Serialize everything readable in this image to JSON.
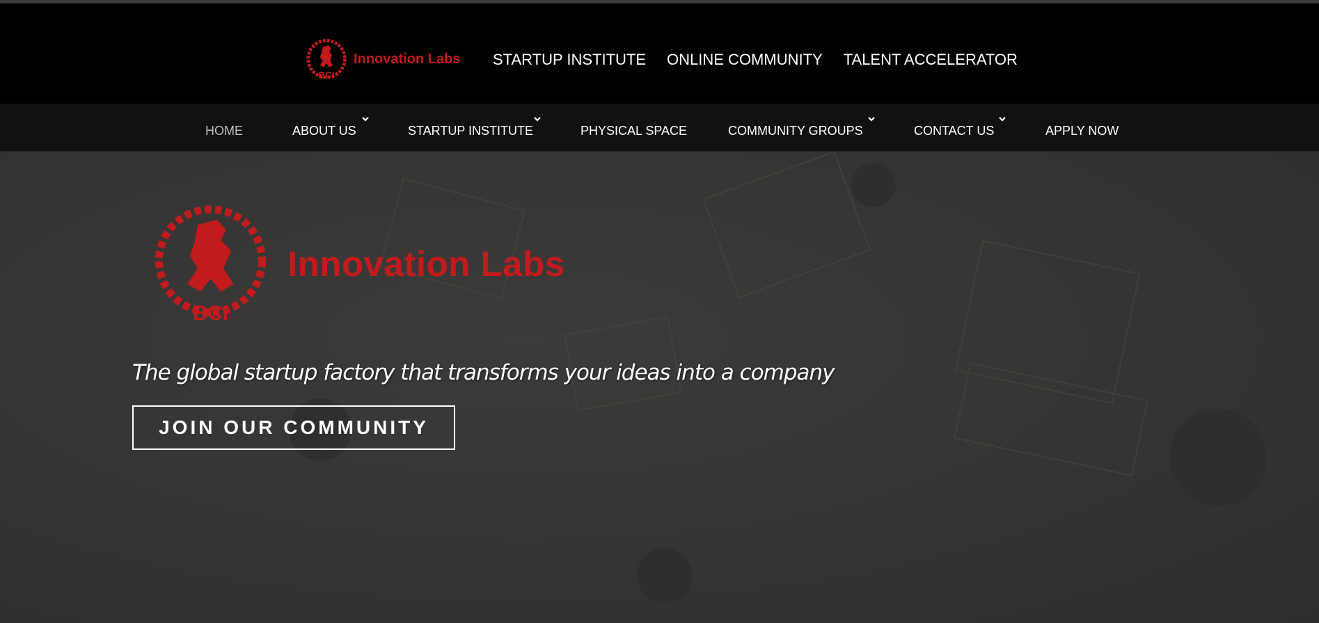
{
  "header": {
    "logo_alt": "BCI",
    "logo_text": "Innovation Labs",
    "top_links": [
      "STARTUP INSTITUTE",
      "ONLINE COMMUNITY",
      "TALENT ACCELERATOR"
    ]
  },
  "nav": {
    "items": [
      {
        "label": "HOME",
        "active": true,
        "has_dropdown": false
      },
      {
        "label": "ABOUT US",
        "active": false,
        "has_dropdown": true
      },
      {
        "label": "STARTUP INSTITUTE",
        "active": false,
        "has_dropdown": true
      },
      {
        "label": "PHYSICAL SPACE",
        "active": false,
        "has_dropdown": false
      },
      {
        "label": "COMMUNITY GROUPS",
        "active": false,
        "has_dropdown": true
      },
      {
        "label": "CONTACT US",
        "active": false,
        "has_dropdown": true
      },
      {
        "label": "APPLY NOW",
        "active": false,
        "has_dropdown": false
      }
    ]
  },
  "hero": {
    "logo_text": "Innovation Labs",
    "emblem_text": "BCI",
    "tagline": "The global startup factory that transforms your ideas into a company",
    "cta_label": "JOIN OUR COMMUNITY"
  },
  "colors": {
    "brand_red": "#c11b1e",
    "header_bg": "#000000",
    "nav_bg": "#111111",
    "hero_bg": "#353433"
  }
}
